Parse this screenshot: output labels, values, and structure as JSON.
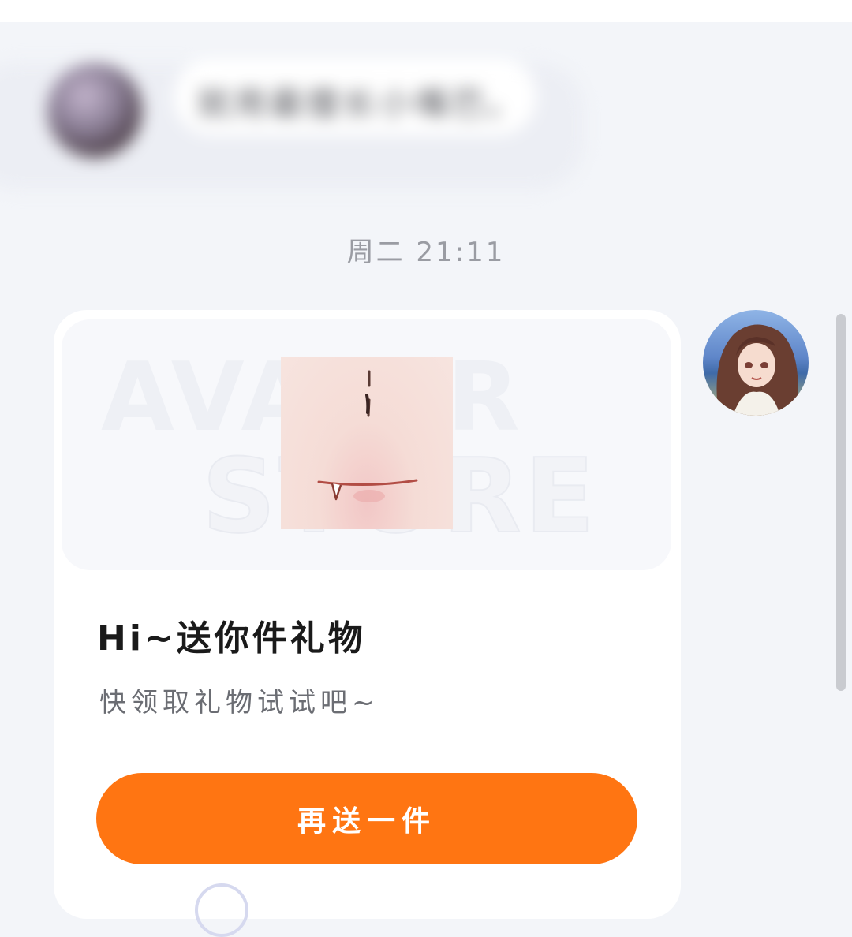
{
  "blurred_message": {
    "text": "就用最擅长小嘴巴。"
  },
  "timestamp": "周二 21:11",
  "gift_card": {
    "watermark_line1": "AVATAR",
    "watermark_line2": "STORE",
    "title": "Hi~送你件礼物",
    "subtitle": "快领取礼物试试吧~",
    "button_label": "再送一件"
  },
  "colors": {
    "background": "#f3f5f9",
    "button": "#ff7512",
    "card": "#ffffff"
  },
  "icons": {
    "self_avatar": "user-avatar-image",
    "gift_preview": "face-accessory-image"
  }
}
